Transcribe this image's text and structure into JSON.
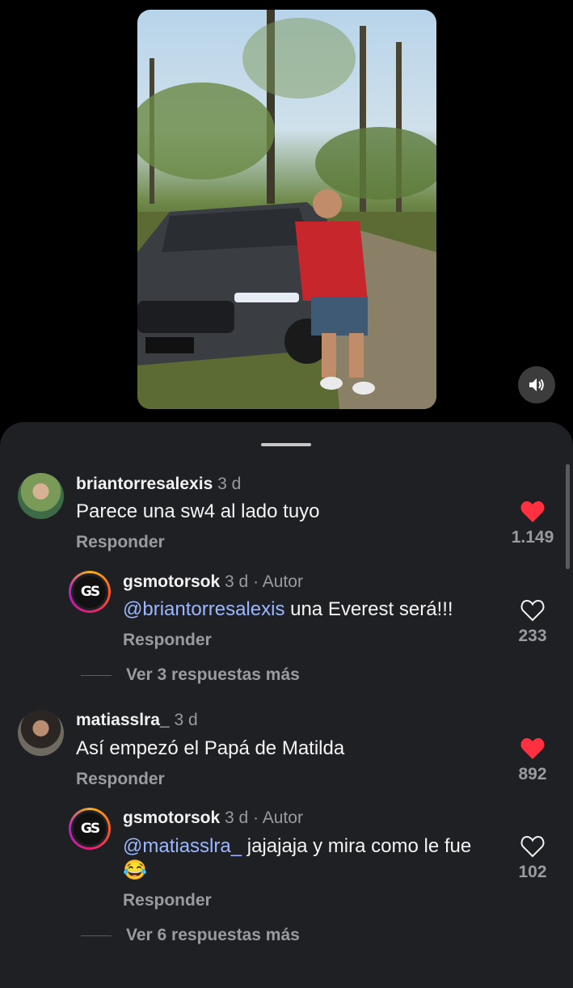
{
  "colors": {
    "sheet_bg": "#1f2024",
    "liked": "#ff3040",
    "mention": "#9bb7ff",
    "muted": "#9a9ba0"
  },
  "video": {
    "sound_icon": "speaker-icon"
  },
  "comments": [
    {
      "username": "briantorresalexis",
      "time": "3 d",
      "text": "Parece una sw4 al lado tuyo",
      "reply_label": "Responder",
      "likes": "1.149",
      "liked": true,
      "replies": [
        {
          "username": "gsmotorsok",
          "time": "3 d",
          "author_label": "· Autor",
          "mention": "@briantorresalexis",
          "text": " una Everest será!!!",
          "reply_label": "Responder",
          "likes": "233",
          "liked": false
        }
      ],
      "more_replies": "Ver 3 respuestas más"
    },
    {
      "username": "matiasslra_",
      "time": "3 d",
      "text": "Así empezó el Papá de Matilda",
      "reply_label": "Responder",
      "likes": "892",
      "liked": true,
      "replies": [
        {
          "username": "gsmotorsok",
          "time": "3 d",
          "author_label": "· Autor",
          "mention": "@matiasslra_",
          "text": " jajajaja y mira como le fue 😂",
          "reply_label": "Responder",
          "likes": "102",
          "liked": false
        }
      ],
      "more_replies": "Ver 6 respuestas más"
    }
  ],
  "brand_avatar_text": "GS"
}
